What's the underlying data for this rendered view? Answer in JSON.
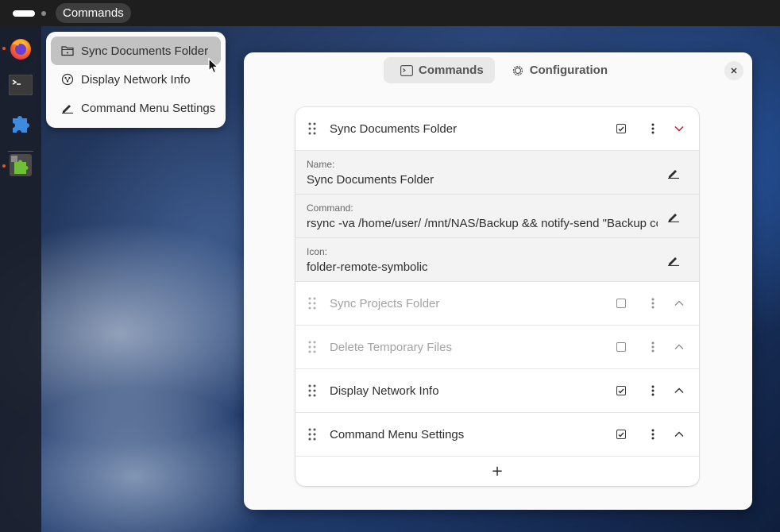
{
  "topbar": {
    "menu_label": "Commands"
  },
  "dock": {
    "items": [
      {
        "name": "firefox-icon",
        "running": true
      },
      {
        "name": "terminal-icon",
        "running": false
      },
      {
        "name": "extensions-icon",
        "running": false
      },
      {
        "name": "extension-manager-icon",
        "running": true
      }
    ]
  },
  "popup": {
    "items": [
      {
        "label": "Sync Documents Folder",
        "icon": "folder-remote-icon",
        "highlighted": true
      },
      {
        "label": "Display Network Info",
        "icon": "network-icon",
        "highlighted": false
      },
      {
        "label": "Command Menu Settings",
        "icon": "settings-pen-icon",
        "highlighted": false
      }
    ]
  },
  "window": {
    "tabs": [
      {
        "label": "Commands",
        "icon": "terminal-icon",
        "selected": true
      },
      {
        "label": "Configuration",
        "icon": "gear-icon",
        "selected": false
      }
    ],
    "commands": [
      {
        "title": "Sync Documents Folder",
        "enabled": true,
        "expanded": true,
        "fields": [
          {
            "label": "Name:",
            "value": "Sync Documents Folder"
          },
          {
            "label": "Command:",
            "value": "rsync -va /home/user/ /mnt/NAS/Backup && notify-send \"Backup complete\""
          },
          {
            "label": "Icon:",
            "value": "folder-remote-symbolic"
          }
        ]
      },
      {
        "title": "Sync Projects Folder",
        "enabled": false,
        "expanded": false
      },
      {
        "title": "Delete Temporary Files",
        "enabled": false,
        "expanded": false
      },
      {
        "title": "Display Network Info",
        "enabled": true,
        "expanded": false
      },
      {
        "title": "Command Menu Settings",
        "enabled": true,
        "expanded": false
      }
    ],
    "add_label": "+"
  },
  "colors": {
    "accent": "#e95420",
    "chevron_expanded": "#c01c28"
  }
}
